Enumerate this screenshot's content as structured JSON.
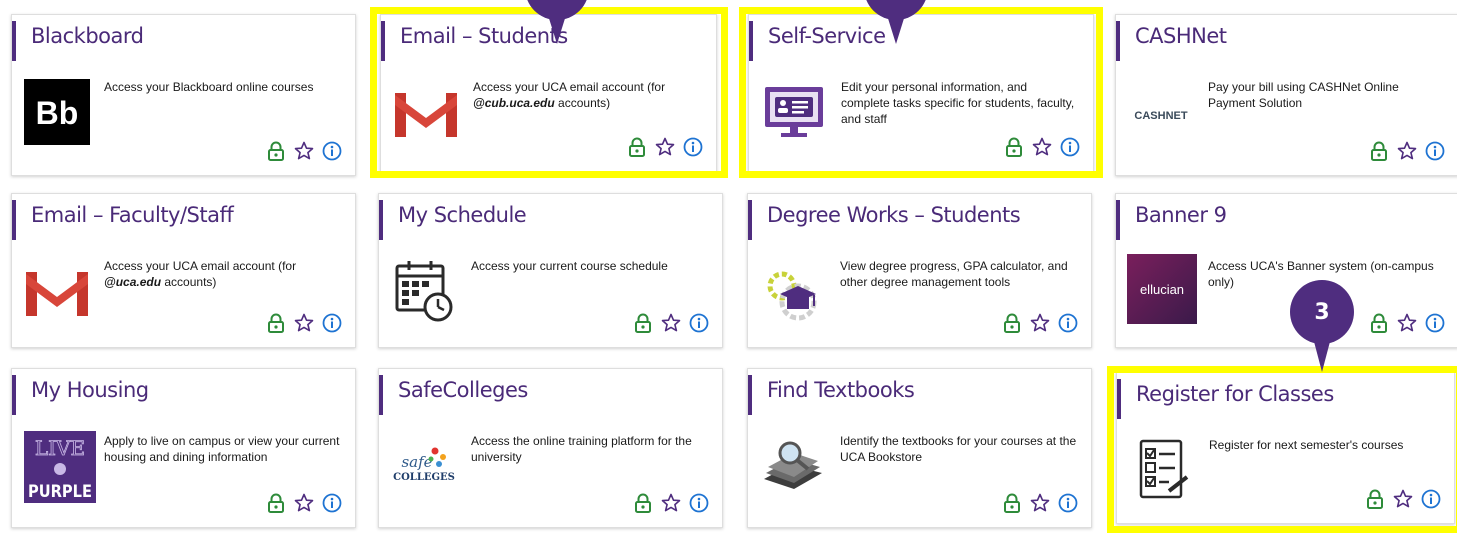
{
  "colors": {
    "accent": "#4f2d7f",
    "lock_green": "#2e8b3a",
    "star_purple": "#4f2d7f",
    "info_blue": "#1e73d2",
    "highlight": "#ffff00"
  },
  "action_icons": [
    "lock-icon",
    "star-icon",
    "info-icon"
  ],
  "cards": [
    {
      "title": "Blackboard",
      "desc": "Access your Blackboard online courses",
      "logo": "blackboard-logo",
      "logo_text": "Bb"
    },
    {
      "title": "Email – Students",
      "desc_pre": "Access your UCA email account (for ",
      "desc_em": "@cub.uca.edu",
      "desc_post": " accounts)",
      "logo": "gmail-icon"
    },
    {
      "title": "Self-Service",
      "desc": "Edit your personal information, and complete tasks specific for students, faculty, and staff",
      "logo": "profile-screen-icon"
    },
    {
      "title": "CASHNet",
      "desc": "Pay your bill using CASHNet Online Payment Solution",
      "logo": "cashnet-logo",
      "logo_text": "CASHNET"
    },
    {
      "title": "Email – Faculty/Staff",
      "desc_pre": "Access your UCA email account (for ",
      "desc_em": "@uca.edu",
      "desc_post": " accounts)",
      "logo": "gmail-icon"
    },
    {
      "title": "My Schedule",
      "desc": "Access your current course schedule",
      "logo": "calendar-clock-icon"
    },
    {
      "title": "Degree Works – Students",
      "desc": "View degree progress, GPA calculator, and other degree management tools",
      "logo": "graduation-gear-icon"
    },
    {
      "title": "Banner 9",
      "desc": "Access UCA's Banner system (on-campus only)",
      "logo": "ellucian-logo",
      "logo_text": "ellucian"
    },
    {
      "title": "My Housing",
      "desc": "Apply to live on campus or view your current housing and dining information",
      "logo": "live-purple-logo",
      "logo_text_top": "LIVE",
      "logo_text_bottom": "PURPLE"
    },
    {
      "title": "SafeColleges",
      "desc": "Access the online training platform for the university",
      "logo": "safecolleges-logo",
      "logo_text_top": "safe",
      "logo_text_bottom": "COLLEGES"
    },
    {
      "title": "Find Textbooks",
      "desc": "Identify the textbooks for your courses at the UCA Bookstore",
      "logo": "textbook-search-icon"
    },
    {
      "title": "Register for Classes",
      "desc": "Register for next semester's courses",
      "logo": "checklist-icon"
    }
  ],
  "markers": [
    {
      "label": "3"
    }
  ]
}
